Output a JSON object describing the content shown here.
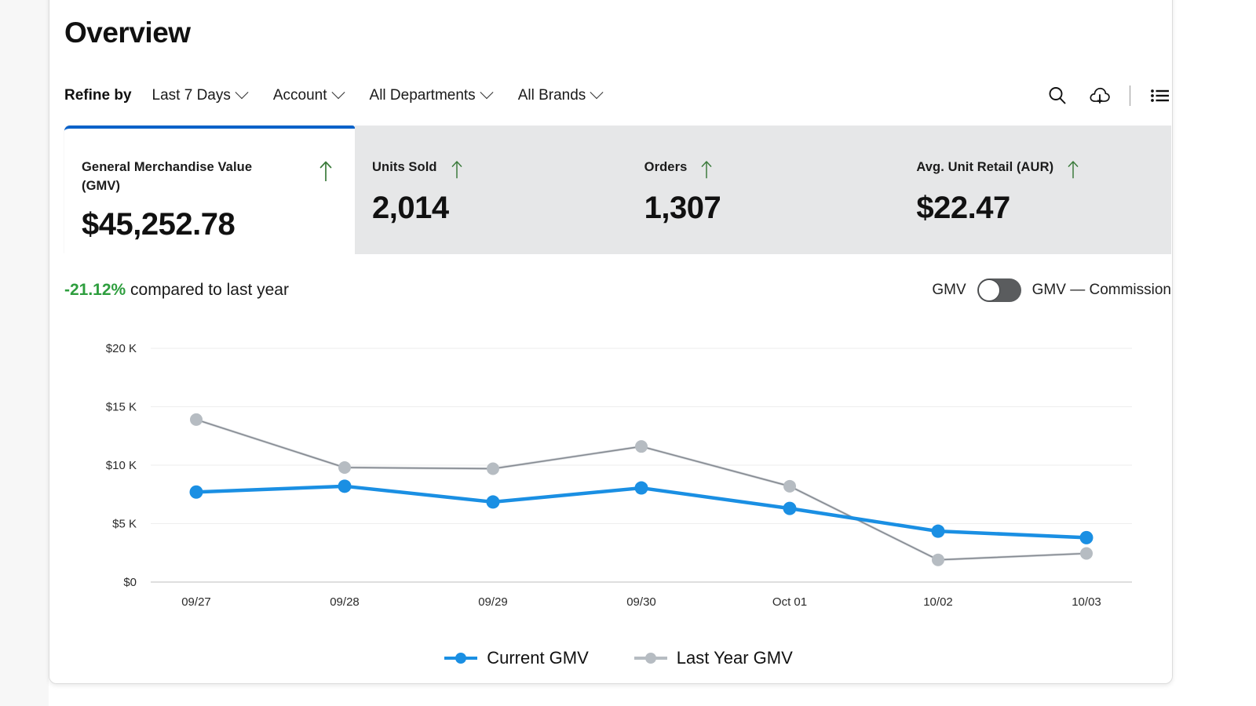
{
  "header": {
    "title": "Overview",
    "refine_label": "Refine by",
    "filters": [
      {
        "label": "Last 7 Days"
      },
      {
        "label": "Account"
      },
      {
        "label": "All Departments"
      },
      {
        "label": "All Brands"
      }
    ],
    "actions": [
      {
        "name": "search-icon"
      },
      {
        "name": "cloud-download-icon"
      },
      {
        "name": "list-view-icon"
      }
    ]
  },
  "kpis": [
    {
      "title": "General Merchandise Value (GMV)",
      "value": "$45,252.78",
      "trend": "up",
      "active": true
    },
    {
      "title": "Units Sold",
      "value": "2,014",
      "trend": "up",
      "active": false
    },
    {
      "title": "Orders",
      "value": "1,307",
      "trend": "up",
      "active": false
    },
    {
      "title": "Avg. Unit Retail (AUR)",
      "value": "$22.47",
      "trend": "up",
      "active": false
    }
  ],
  "comparison": {
    "delta": "-21.12%",
    "text": " compared to last year",
    "delta_color": "#2e9e3e"
  },
  "metric_toggle": {
    "left_label": "GMV",
    "right_label": "GMV — Commission",
    "state": "off"
  },
  "colors": {
    "accent_blue": "#0a62c9",
    "series_current": "#1a8fe3",
    "series_last_year": "#b6bcc2",
    "series_last_year_line": "#4a4f55",
    "grid": "#eeeeee",
    "kpi_inactive_bg": "#e6e7e8",
    "positive_green": "#2e9e3e"
  },
  "chart_data": {
    "type": "line",
    "title": "",
    "xlabel": "",
    "ylabel": "",
    "categories": [
      "09/27",
      "09/28",
      "09/29",
      "09/30",
      "Oct 01",
      "10/02",
      "10/03"
    ],
    "ytick_labels": [
      "$0",
      "$5 K",
      "$10 K",
      "$15 K",
      "$20 K"
    ],
    "ytick_values": [
      0,
      5000,
      10000,
      15000,
      20000
    ],
    "ylim": [
      0,
      20000
    ],
    "grid": true,
    "legend_position": "bottom",
    "series": [
      {
        "name": "Current GMV",
        "color": "#1a8fe3",
        "values": [
          7700,
          8200,
          6850,
          8050,
          6300,
          4350,
          3800
        ]
      },
      {
        "name": "Last Year GMV",
        "color": "#b6bcc2",
        "values": [
          13900,
          9800,
          9700,
          11600,
          8200,
          1900,
          2450
        ]
      }
    ]
  }
}
